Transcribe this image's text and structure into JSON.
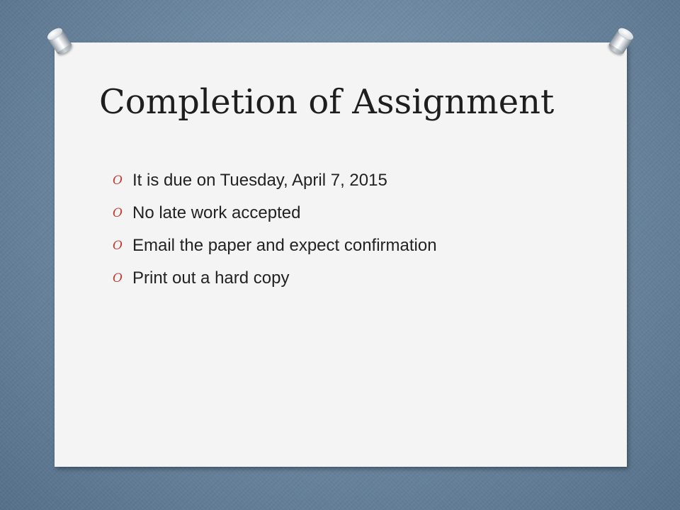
{
  "slide": {
    "title": "Completion of Assignment",
    "bullet_marker": "O",
    "bullets": [
      "It is due on Tuesday, April 7, 2015",
      "No late work accepted",
      "Email the paper and expect confirmation",
      "Print out a hard copy"
    ]
  },
  "colors": {
    "background": "#6f8aa3",
    "paper": "#f4f4f4",
    "bullet_marker": "#c0392b",
    "text": "#222222"
  }
}
